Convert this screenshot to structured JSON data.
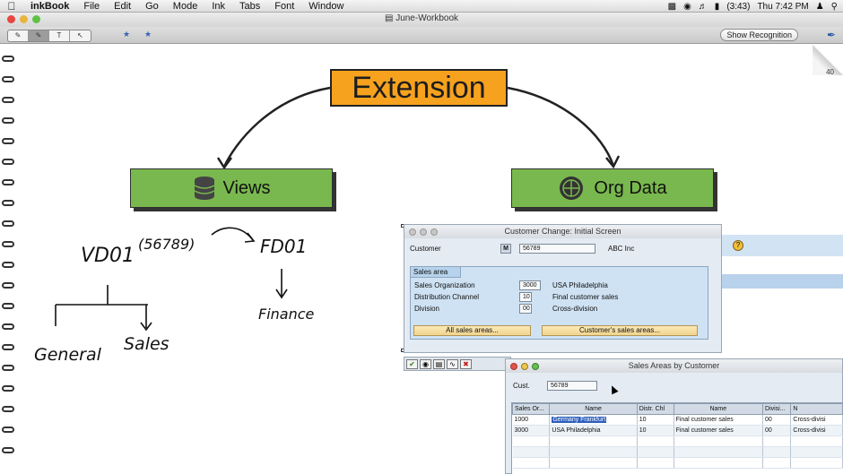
{
  "menubar": {
    "app_name": "inkBook",
    "items": [
      "File",
      "Edit",
      "Go",
      "Mode",
      "Ink",
      "Tabs",
      "Font",
      "Window"
    ],
    "battery": "(3:43)",
    "clock": "Thu 7:42 PM"
  },
  "window": {
    "title": "June-Workbook"
  },
  "toolbar": {
    "show_recognition": "Show Recognition",
    "page_number": "40"
  },
  "diagram": {
    "top_box": "Extension",
    "left_box": "Views",
    "right_box": "Org Data",
    "colors": {
      "top_box": "#f6a21e",
      "child_boxes": "#79b84e"
    },
    "handwriting": {
      "vd01": "VD01",
      "number": "(56789)",
      "fd01": "FD01",
      "general": "General",
      "sales": "Sales",
      "finance": "Finance"
    }
  },
  "sap_customer_change": {
    "title": "Customer Change: Initial Screen",
    "customer_label": "Customer",
    "customer_value": "56789",
    "customer_name": "ABC Inc",
    "group_title": "Sales area",
    "rows": [
      {
        "label": "Sales Organization",
        "value": "3000",
        "text": "USA Philadelphia"
      },
      {
        "label": "Distribution Channel",
        "value": "10",
        "text": "Final customer sales"
      },
      {
        "label": "Division",
        "value": "00",
        "text": "Cross-division"
      }
    ],
    "btn_all": "All sales areas...",
    "btn_customer": "Customer's sales areas..."
  },
  "sap_sales_areas": {
    "title": "Sales Areas by Customer",
    "cust_label": "Cust.",
    "cust_value": "56789",
    "columns": [
      "Sales Or...",
      "Name",
      "Distr. Chl",
      "Name",
      "Divisi...",
      "N"
    ],
    "rows": [
      [
        "1000",
        "Germany Frankfurt",
        "10",
        "Final customer sales",
        "00",
        "Cross-divisi"
      ],
      [
        "3000",
        "USA Philadelphia",
        "10",
        "Final customer sales",
        "00",
        "Cross-divisi"
      ]
    ]
  }
}
